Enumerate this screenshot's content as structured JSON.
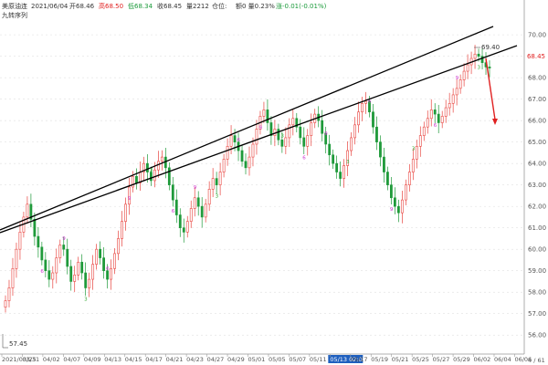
{
  "header": {
    "symbol": "美原油连",
    "date": "2021/06/04",
    "open": "开68.46",
    "high": "高68.50",
    "low": "低68.34",
    "close": "收68.45",
    "volume": "量2212",
    "position": "仓位:",
    "change": "额0 量0.23%",
    "pct": "涨-0.01(-0.01%)",
    "indicator": "九转序列"
  },
  "colors": {
    "up": "#e8433e",
    "down": "#1f9a3a",
    "trendline": "#000000",
    "arrow": "#e02020",
    "signal": "#cc33cc"
  },
  "chart_data": {
    "type": "candlestick",
    "title": "",
    "ylim": [
      55.2,
      70.6
    ],
    "y_ticks": [
      70.0,
      69.0,
      68.0,
      67.0,
      66.0,
      65.0,
      64.0,
      63.0,
      62.0,
      61.0,
      60.0,
      59.0,
      58.0,
      57.0,
      56.0
    ],
    "x_ticks": [
      "2021/03/25",
      "03/31",
      "04/02",
      "04/07",
      "04/09",
      "04/13",
      "04/15",
      "04/17",
      "04/21",
      "04/23",
      "04/27",
      "04/29",
      "05/01",
      "05/05",
      "05/07",
      "05/11",
      "05/13 02:00",
      "05/17",
      "05/19",
      "05/21",
      "05/25",
      "05/27",
      "05/29",
      "06/02",
      "06/04",
      "06/06"
    ],
    "x_highlight": "05/13 02:00",
    "annotations": {
      "high_label": "69.40",
      "low_label": "57.45",
      "last_price": "68.45",
      "bottom_right": "4 / 61"
    },
    "closes": [
      57.6,
      58.2,
      59.1,
      60.0,
      60.8,
      61.5,
      62.1,
      61.4,
      60.6,
      60.1,
      59.5,
      59.0,
      58.6,
      58.9,
      59.6,
      60.2,
      60.0,
      59.2,
      58.5,
      58.8,
      59.4,
      58.9,
      58.2,
      58.6,
      59.3,
      60.0,
      59.6,
      59.0,
      58.6,
      59.1,
      59.8,
      60.5,
      61.3,
      62.1,
      62.9,
      63.4,
      63.1,
      63.6,
      64.0,
      63.6,
      63.2,
      63.7,
      64.1,
      64.3,
      63.8,
      63.0,
      62.3,
      61.6,
      61.0,
      60.8,
      61.3,
      61.9,
      62.4,
      62.0,
      61.5,
      62.1,
      62.8,
      63.3,
      63.0,
      63.6,
      64.2,
      64.8,
      65.3,
      65.0,
      64.6,
      64.1,
      63.8,
      64.3,
      64.9,
      65.6,
      66.2,
      66.5,
      65.9,
      65.3,
      65.6,
      65.1,
      64.8,
      65.2,
      65.8,
      66.1,
      65.7,
      65.2,
      64.8,
      65.3,
      65.9,
      66.3,
      66.0,
      65.4,
      64.9,
      64.4,
      64.0,
      63.6,
      63.3,
      63.9,
      64.6,
      65.2,
      65.8,
      66.4,
      66.8,
      66.9,
      66.4,
      65.7,
      65.0,
      64.3,
      63.6,
      63.0,
      62.4,
      62.0,
      61.7,
      62.3,
      63.0,
      63.6,
      64.2,
      64.8,
      65.3,
      65.7,
      66.1,
      66.5,
      66.3,
      65.9,
      66.2,
      66.6,
      66.8,
      67.2,
      67.5,
      67.9,
      68.3,
      68.6,
      68.9,
      69.1,
      69.0,
      68.7,
      68.5,
      68.45
    ]
  }
}
